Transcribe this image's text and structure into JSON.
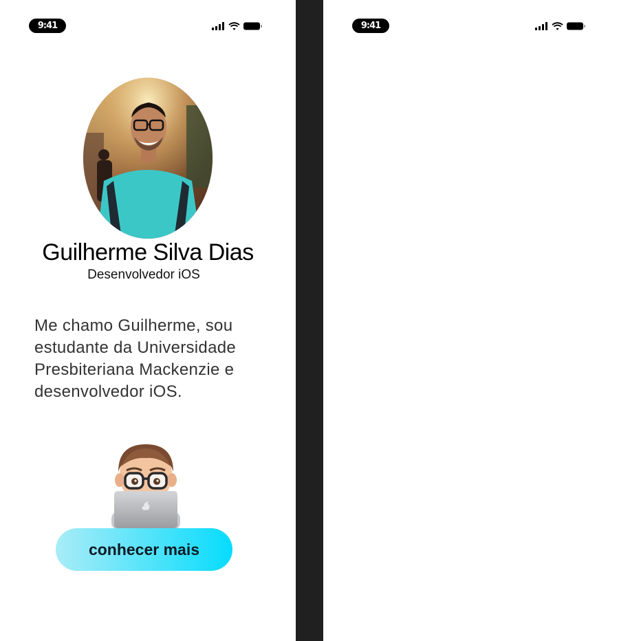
{
  "screens": [
    {
      "status_bar": {
        "time": "9:41",
        "icons": [
          "cellular-signal-icon",
          "wifi-icon",
          "battery-icon"
        ]
      },
      "profile": {
        "name": "Guilherme Silva Dias",
        "role": "Desenvolvedor iOS",
        "bio": "Me chamo Guilherme, sou estudante da Universidade Presbiteriana Mackenzie e desenvolvedor iOS."
      },
      "cta": {
        "label": "conhecer mais"
      }
    },
    {
      "status_bar": {
        "time": "9:41",
        "icons": [
          "cellular-signal-icon",
          "wifi-icon",
          "battery-icon"
        ]
      }
    }
  ],
  "colors": {
    "accent_start": "#a9ecf7",
    "accent_end": "#07dcfd",
    "divider": "#202020"
  }
}
